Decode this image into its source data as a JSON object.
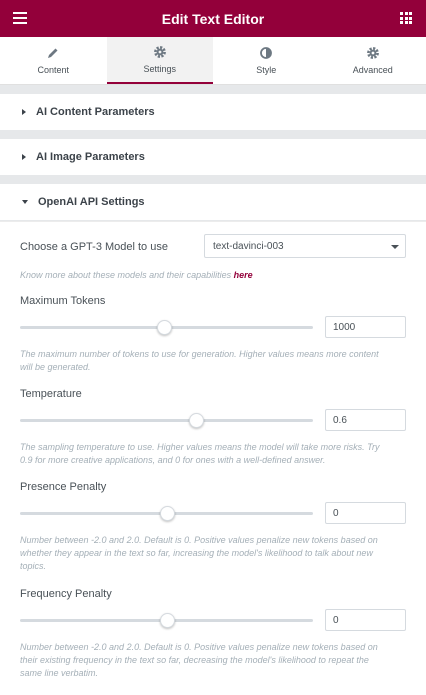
{
  "header": {
    "title": "Edit Text Editor",
    "menu_icon": "hamburger-icon",
    "apps_icon": "grid-icon",
    "color": "#93003a"
  },
  "tabs": [
    {
      "label": "Content",
      "icon": "pencil-icon",
      "active": false
    },
    {
      "label": "Settings",
      "icon": "gear-icon",
      "active": true
    },
    {
      "label": "Style",
      "icon": "half-circle-icon",
      "active": false
    },
    {
      "label": "Advanced",
      "icon": "gear-icon",
      "active": false
    }
  ],
  "sections": {
    "content_params": "AI Content Parameters",
    "image_params": "AI Image Parameters",
    "openai_settings": "OpenAI API Settings"
  },
  "openai": {
    "model_label": "Choose a GPT-3 Model to use",
    "model_value": "text-davinci-003",
    "model_help_text": "Know more about these models and their capabilities",
    "model_help_link": "here",
    "max_tokens": {
      "label": "Maximum Tokens",
      "value": "1000",
      "slider_fraction": 0.49,
      "description": "The maximum number of tokens to use for generation. Higher values means more content will be generated."
    },
    "temperature": {
      "label": "Temperature",
      "value": "0.6",
      "slider_fraction": 0.6,
      "description": "The sampling temperature to use. Higher values means the model will take more risks. Try 0.9 for more creative applications, and 0 for ones with a well-defined answer."
    },
    "presence_penalty": {
      "label": "Presence Penalty",
      "value": "0",
      "slider_fraction": 0.5,
      "description": "Number between -2.0 and 2.0. Default is 0. Positive values penalize new tokens based on whether they appear in the text so far, increasing the model's likelihood to talk about new topics."
    },
    "frequency_penalty": {
      "label": "Frequency Penalty",
      "value": "0",
      "slider_fraction": 0.5,
      "description": "Number between -2.0 and 2.0. Default is 0. Positive values penalize new tokens based on their existing frequency in the text so far, decreasing the model's likelihood to repeat the same line verbatim."
    }
  }
}
